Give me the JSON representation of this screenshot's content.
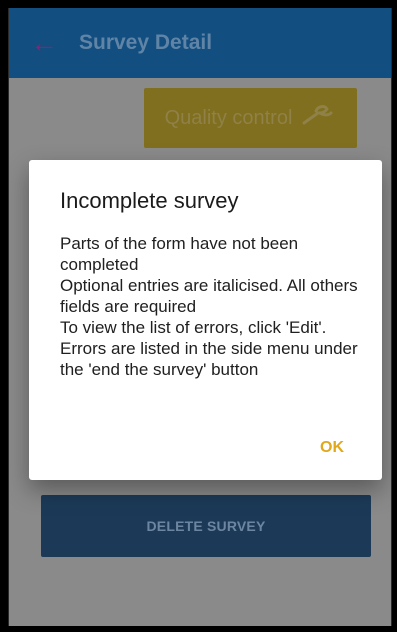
{
  "appbar": {
    "title": "Survey Detail",
    "back_icon": "arrow-left-icon",
    "back_color": "#7a2a72"
  },
  "buttons": {
    "quality_control": "Quality control",
    "quality_control_icon": "wrench-icon",
    "delete_survey": "DELETE SURVEY"
  },
  "dialog": {
    "title": "Incomplete survey",
    "message": "Parts of the form have not been completed\nOptional entries are italicised. All others fields are required\nTo view the list of errors, click 'Edit'. Errors are listed in the side menu under the 'end the survey' button",
    "ok_label": "OK"
  },
  "colors": {
    "appbar_bg": "#124e80",
    "accent_orange": "#e0a81a",
    "quality_control_bg": "#7f6f1f",
    "delete_bg": "#1c3a58",
    "scrim_bg": "#8a8a8a"
  }
}
